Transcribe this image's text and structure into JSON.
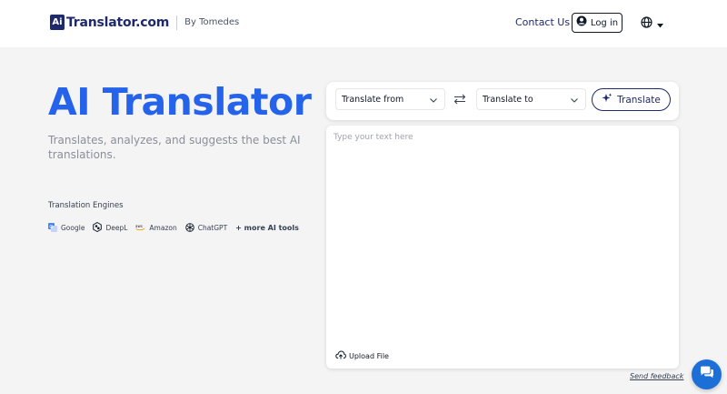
{
  "header": {
    "logo_badge": "Ai",
    "logo_text": "Translator.com",
    "by_text": "By Tomedes",
    "contact_label": "Contact Us",
    "login_label": "Log in"
  },
  "hero": {
    "title": "AI Translator",
    "subtitle": "Translates, analyzes, and suggests the best AI translations.",
    "engines_title": "Translation Engines",
    "engines": [
      {
        "label": "Google",
        "icon": "google-translate-icon"
      },
      {
        "label": "DeepL",
        "icon": "deepl-icon"
      },
      {
        "label": "Amazon",
        "icon": "amazon-icon"
      },
      {
        "label": "ChatGPT",
        "icon": "chatgpt-icon"
      }
    ],
    "more_tools": "+ more AI tools"
  },
  "translator": {
    "from_label": "Translate from",
    "to_label": "Translate to",
    "translate_label": "Translate",
    "input_placeholder": "Type your text here",
    "input_value": "",
    "upload_label": "Upload File"
  },
  "footer": {
    "feedback_label": "Send feedback"
  },
  "colors": {
    "brand": "#1e2a6b",
    "accent": "#2563eb",
    "chat": "#1d6fd8",
    "background": "#f4f4f5"
  }
}
